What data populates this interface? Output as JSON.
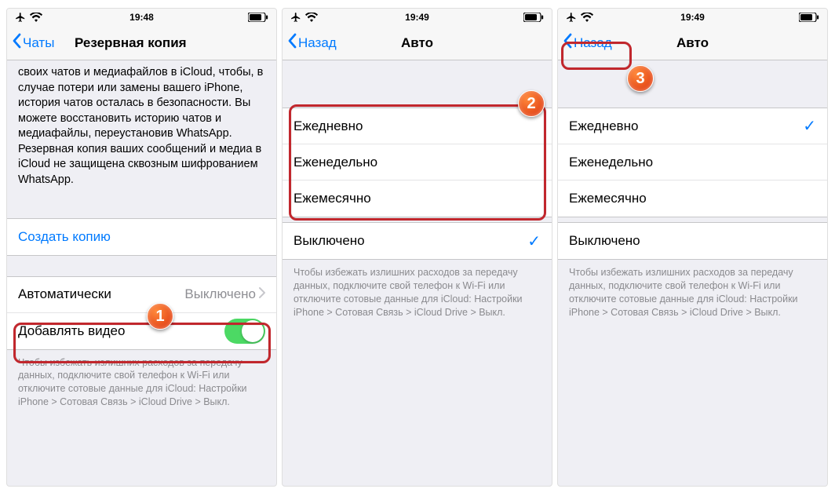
{
  "screen1": {
    "status_time": "19:48",
    "nav_back": "Чаты",
    "nav_title": "Резервная копия",
    "description": "своих чатов и медиафайлов в iCloud, чтобы, в случае потери или замены вашего iPhone, история чатов осталась в безопасности. Вы можете восстановить историю чатов и медиафайлы, переустановив WhatsApp. Резервная копия ваших сообщений и медиа в iCloud не защищена сквозным шифрованием WhatsApp.",
    "create_copy": "Создать копию",
    "auto_label": "Автоматически",
    "auto_value": "Выключено",
    "add_video": "Добавлять видео",
    "footer": "Чтобы избежать излишних расходов за передачу данных, подключите свой телефон к Wi-Fi или отключите сотовые данные для iCloud: Настройки iPhone > Сотовая Связь > iCloud Drive > Выкл.",
    "step": "1"
  },
  "screen2": {
    "status_time": "19:49",
    "nav_back": "Назад",
    "nav_title": "Авто",
    "options": [
      "Ежедневно",
      "Еженедельно",
      "Ежемесячно"
    ],
    "off_label": "Выключено",
    "footer": "Чтобы избежать излишних расходов за передачу данных, подключите свой телефон к Wi-Fi или отключите сотовые данные для iCloud: Настройки iPhone > Сотовая Связь > iCloud Drive > Выкл.",
    "step": "2"
  },
  "screen3": {
    "status_time": "19:49",
    "nav_back": "Назад",
    "nav_title": "Авто",
    "options": [
      "Ежедневно",
      "Еженедельно",
      "Ежемесячно"
    ],
    "selected_index": 0,
    "off_label": "Выключено",
    "footer": "Чтобы избежать излишних расходов за передачу данных, подключите свой телефон к Wi-Fi или отключите сотовые данные для iCloud: Настройки iPhone > Сотовая Связь > iCloud Drive > Выкл.",
    "step": "3"
  }
}
